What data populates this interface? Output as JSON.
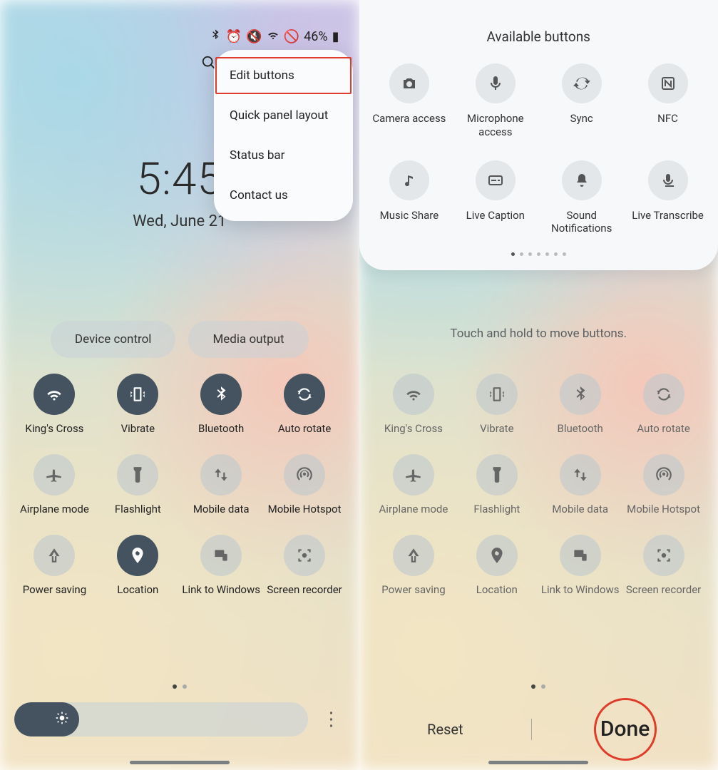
{
  "status_bar": {
    "battery": "46%"
  },
  "popup": {
    "items": [
      "Edit buttons",
      "Quick panel layout",
      "Status bar",
      "Contact us"
    ]
  },
  "clock": {
    "time": "5:45",
    "date": "Wed, June 21"
  },
  "pills": {
    "device_control": "Device control",
    "media_output": "Media output"
  },
  "tiles": [
    {
      "label": "King's Cross",
      "icon": "wifi",
      "on": true
    },
    {
      "label": "Vibrate",
      "icon": "vibrate",
      "on": true
    },
    {
      "label": "Bluetooth",
      "icon": "bluetooth",
      "on": true
    },
    {
      "label": "Auto rotate",
      "icon": "rotate",
      "on": true
    },
    {
      "label": "Airplane mode",
      "icon": "airplane",
      "on": false
    },
    {
      "label": "Flashlight",
      "icon": "flashlight",
      "on": false
    },
    {
      "label": "Mobile data",
      "icon": "mobiledata",
      "on": false
    },
    {
      "label": "Mobile Hotspot",
      "icon": "hotspot",
      "on": false
    },
    {
      "label": "Power saving",
      "icon": "power",
      "on": false
    },
    {
      "label": "Location",
      "icon": "location",
      "on": true
    },
    {
      "label": "Link to Windows",
      "icon": "link",
      "on": false
    },
    {
      "label": "Screen recorder",
      "icon": "record",
      "on": false
    }
  ],
  "right": {
    "avail_title": "Available buttons",
    "hint": "Touch and hold to move buttons.",
    "avail": [
      {
        "label": "Camera access",
        "icon": "camera"
      },
      {
        "label": "Microphone access",
        "icon": "mic"
      },
      {
        "label": "Sync",
        "icon": "sync"
      },
      {
        "label": "NFC",
        "icon": "nfc"
      },
      {
        "label": "Music Share",
        "icon": "music"
      },
      {
        "label": "Live Caption",
        "icon": "caption"
      },
      {
        "label": "Sound Notifications",
        "icon": "bell"
      },
      {
        "label": "Live Transcribe",
        "icon": "transcribe"
      }
    ],
    "reset": "Reset",
    "done": "Done"
  },
  "right_tiles": [
    {
      "label": "King's Cross",
      "icon": "wifi"
    },
    {
      "label": "Vibrate",
      "icon": "vibrate"
    },
    {
      "label": "Bluetooth",
      "icon": "bluetooth"
    },
    {
      "label": "Auto rotate",
      "icon": "rotate"
    },
    {
      "label": "Airplane mode",
      "icon": "airplane"
    },
    {
      "label": "Flashlight",
      "icon": "flashlight"
    },
    {
      "label": "Mobile data",
      "icon": "mobiledata"
    },
    {
      "label": "Mobile Hotspot",
      "icon": "hotspot"
    },
    {
      "label": "Power saving",
      "icon": "power"
    },
    {
      "label": "Location",
      "icon": "location"
    },
    {
      "label": "Link to Windows",
      "icon": "link"
    },
    {
      "label": "Screen recorder",
      "icon": "record"
    }
  ]
}
